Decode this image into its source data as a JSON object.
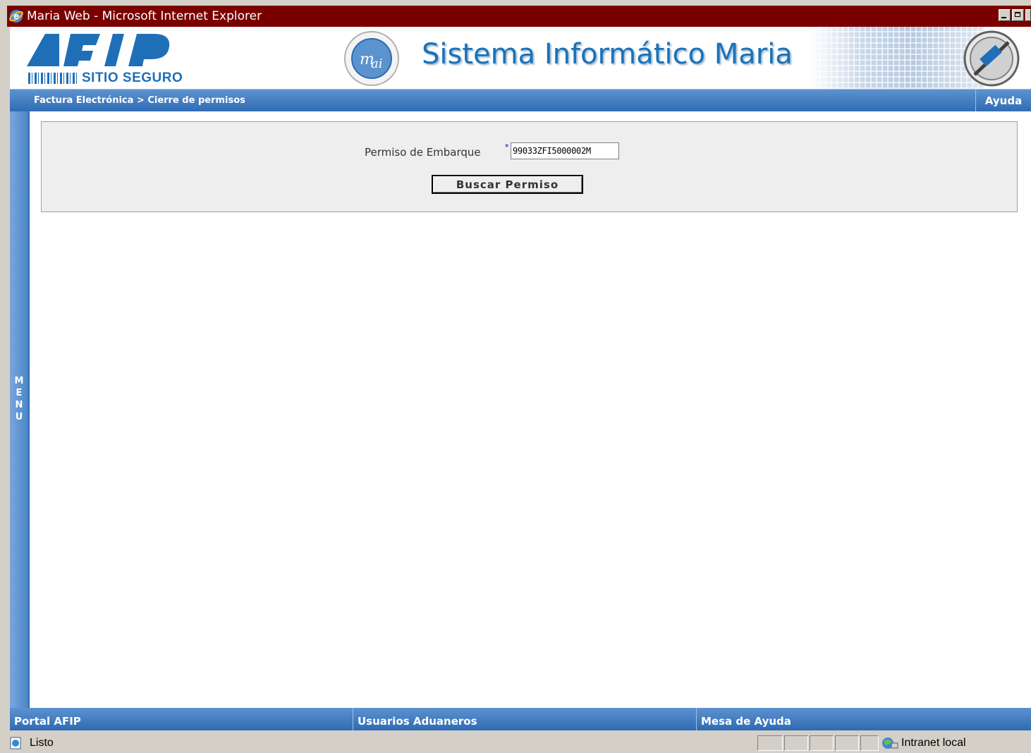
{
  "window": {
    "title": "Maria Web - Microsoft Internet Explorer"
  },
  "header": {
    "logo_text": "SITIO SEGURO",
    "system_title": "Sistema Informático Maria"
  },
  "nav": {
    "breadcrumb": "Factura Electrónica > Cierre de permisos",
    "help_label": "Ayuda"
  },
  "menu": {
    "label": "MENU"
  },
  "form": {
    "label": "Permiso de Embarque",
    "required_mark": "*",
    "value": "99033ZFI5000002M",
    "button_label": "Buscar Permiso"
  },
  "footer": {
    "links": [
      "Portal AFIP",
      "Usuarios Aduaneros",
      "Mesa de Ayuda"
    ]
  },
  "status": {
    "text": "Listo",
    "zone": "Intranet local"
  },
  "colors": {
    "titlebar": "#7a0000",
    "nav_blue": "#2f6bb3",
    "title_blue": "#1a72b8"
  }
}
